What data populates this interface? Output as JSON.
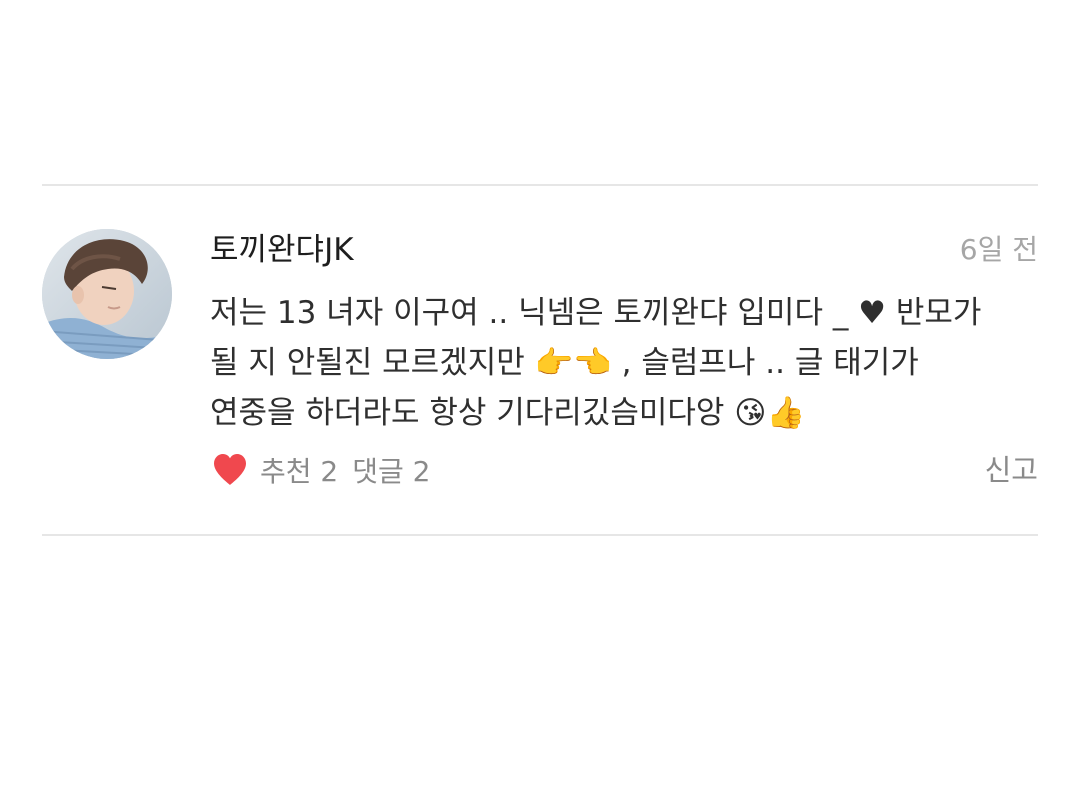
{
  "comment": {
    "author": "토끼완댜JK",
    "time": "6일 전",
    "body_lines": [
      "저는 13 녀자 이구여 .. 닉넴은 토끼완댜 입미다 _ ♥ 반모가",
      "될 지 안될진 모르겠지만 👉👈 , 슬럼프나 .. 글 태기가",
      "연중을 하더라도  항상 기다리깄슴미다앙 😘👍"
    ],
    "likes_label": "추천 2",
    "replies_label": "댓글 2",
    "report_label": "신고"
  },
  "icons": {
    "avatar": "profile-photo",
    "like": "heart-icon"
  },
  "colors": {
    "like_heart": "#f0484e",
    "divider": "#e6e6e6",
    "meta_text": "#8a8a8a"
  }
}
